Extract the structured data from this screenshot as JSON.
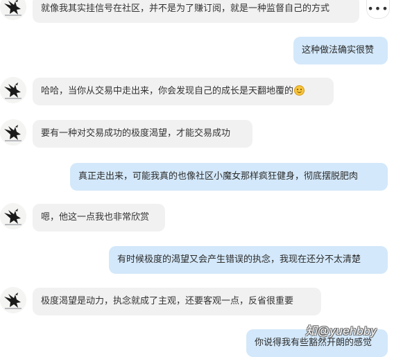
{
  "toolbar": {
    "more_icon": "more-horizontal-icon",
    "more_label": "•••"
  },
  "messages": [
    {
      "side": "in",
      "text": "就像我其实挂信号在社区，并不是为了赚订阅，就是一种监督自己的方式"
    },
    {
      "side": "out",
      "text": "这种做法确实很赞"
    },
    {
      "side": "in",
      "text": "哈哈，当你从交易中走出来，你会发现自己的成长是天翻地覆的",
      "emoji": "slightly-smiling-face-icon"
    },
    {
      "side": "in",
      "text": "要有一种对交易成功的极度渴望，才能交易成功"
    },
    {
      "side": "out",
      "text": "真正走出来，可能我真的也像社区小魔女那样疯狂健身，彻底摆脱肥肉"
    },
    {
      "side": "in",
      "text": "嗯，他这一点我也非常欣赏"
    },
    {
      "side": "out",
      "text": "有时候极度的渴望又会产生错误的执念，我现在还分不太清楚"
    },
    {
      "side": "in",
      "text": "极度渴望是动力，执念就成了主观，还要客观一点，反省很重要"
    },
    {
      "side": "out",
      "text": "你说得我有些豁然开朗的感觉"
    }
  ],
  "watermark": "知@yuehbby",
  "colors": {
    "incoming_bubble": "#f1f1f1",
    "outgoing_bubble": "#d3e8fa"
  },
  "avatar_icon": "eagle-avatar-icon"
}
